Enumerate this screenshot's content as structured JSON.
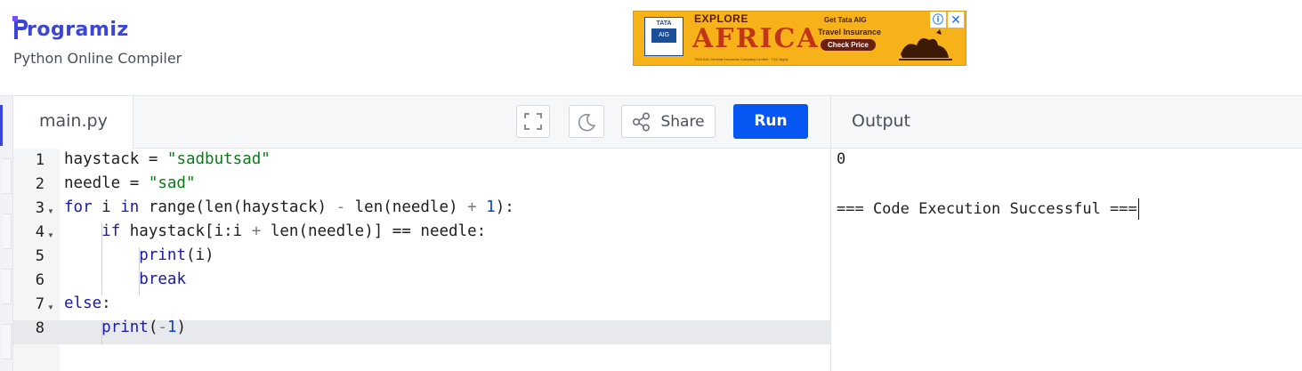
{
  "header": {
    "logo_text": "rogramiz",
    "subtitle": "Python Online Compiler"
  },
  "ad": {
    "brand": "TATA",
    "brand_sub": "AIG",
    "headline_top": "EXPLORE",
    "headline_main": "AFRICA",
    "line1": "Get Tata AIG",
    "line2": "Travel Insurance",
    "cta": "Check Price",
    "fine_print": "TATA AIG General Insurance Company Limited · T&C Apply",
    "info_icon": "info-icon",
    "close_icon": "close-icon"
  },
  "editor": {
    "tab_label": "main.py",
    "share_label": "Share",
    "run_label": "Run",
    "active_line": 8,
    "lines": [
      {
        "num": "1",
        "fold": false
      },
      {
        "num": "2",
        "fold": false
      },
      {
        "num": "3",
        "fold": true
      },
      {
        "num": "4",
        "fold": true
      },
      {
        "num": "5",
        "fold": false
      },
      {
        "num": "6",
        "fold": false
      },
      {
        "num": "7",
        "fold": true
      },
      {
        "num": "8",
        "fold": false
      }
    ],
    "code": [
      "haystack = \"sadbutsad\"",
      "needle = \"sad\"",
      "for i in range(len(haystack) - len(needle) + 1):",
      "    if haystack[i:i + len(needle)] == needle:",
      "        print(i)",
      "        break",
      "else:",
      "    print(-1)"
    ]
  },
  "output": {
    "title": "Output",
    "lines": [
      "0",
      "",
      "=== Code Execution Successful ==="
    ]
  },
  "colors": {
    "brand": "#3b46d6",
    "run_button": "#0556f3",
    "keyword": "#1a1aa6",
    "string": "#0b7a1b"
  }
}
